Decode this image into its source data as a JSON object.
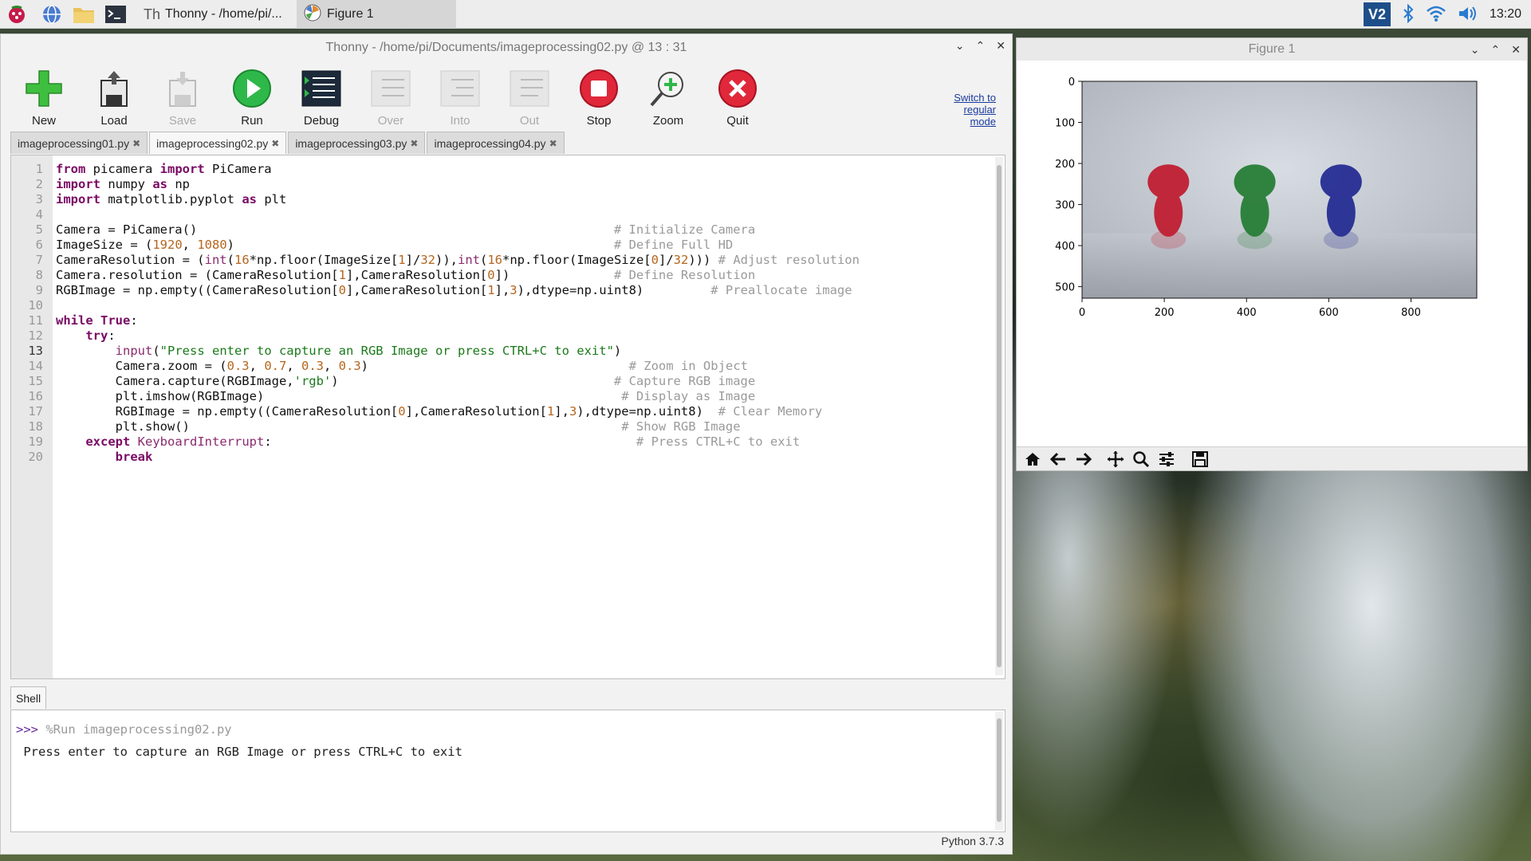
{
  "taskbar": {
    "tasks": [
      {
        "label": "Thonny  -  /home/pi/..."
      },
      {
        "label": "Figure 1"
      }
    ],
    "clock": "13:20"
  },
  "thonny": {
    "title": "Thonny  -  /home/pi/Documents/imageprocessing02.py  @  13 : 31",
    "toolbar": {
      "new": "New",
      "load": "Load",
      "save": "Save",
      "run": "Run",
      "debug": "Debug",
      "over": "Over",
      "into": "Into",
      "out": "Out",
      "stop": "Stop",
      "zoom": "Zoom",
      "quit": "Quit"
    },
    "switch_mode": "Switch to regular mode",
    "tabs": [
      {
        "label": "imageprocessing01.py"
      },
      {
        "label": "imageprocessing02.py"
      },
      {
        "label": "imageprocessing03.py"
      },
      {
        "label": "imageprocessing04.py"
      }
    ],
    "line_numbers": [
      "1",
      "2",
      "3",
      "4",
      "5",
      "6",
      "7",
      "8",
      "9",
      "10",
      "11",
      "12",
      "13",
      "14",
      "15",
      "16",
      "17",
      "18",
      "19",
      "20"
    ],
    "shell_tab": "Shell",
    "shell_prompt": ">>>",
    "shell_command": "%Run imageprocessing02.py",
    "shell_output": "Press enter to capture an RGB Image or press CTRL+C to exit",
    "status": "Python 3.7.3"
  },
  "figure": {
    "title": "Figure 1",
    "chart_data": {
      "type": "image",
      "xticks": [
        0,
        200,
        400,
        600,
        800
      ],
      "yticks": [
        0,
        100,
        200,
        300,
        400,
        500
      ],
      "xlim": [
        0,
        960
      ],
      "ylim": [
        528,
        0
      ]
    }
  }
}
